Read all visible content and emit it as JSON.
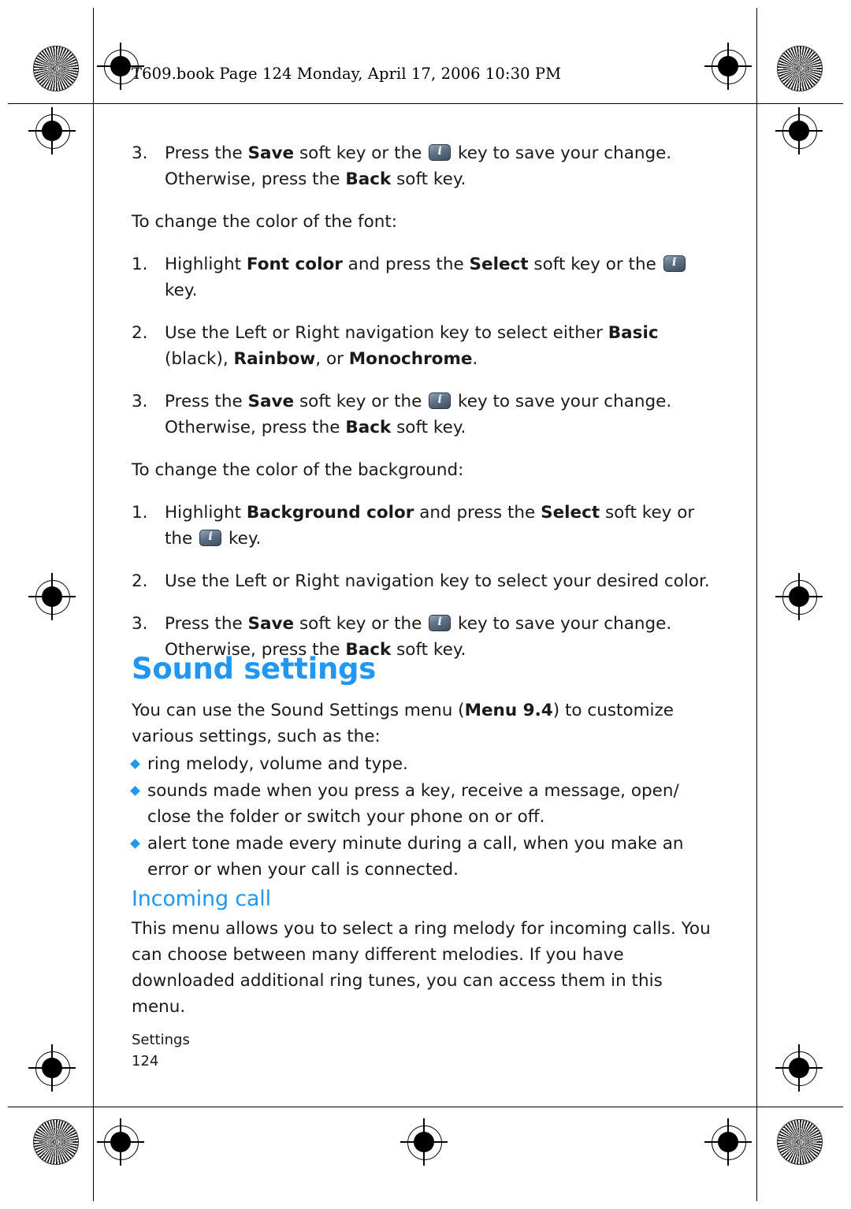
{
  "header": {
    "text": "T609.book  Page 124  Monday, April 17, 2006  10:30 PM"
  },
  "body": {
    "step3a": {
      "num": "3.",
      "part1": "Press the ",
      "save": "Save",
      "part2": " soft key or the ",
      "part3": " key to save your change. Otherwise, press the ",
      "back": "Back",
      "part4": " soft key."
    },
    "intro_font_color": "To change the color of the font:",
    "step1_font": {
      "num": "1.",
      "part1": "Highlight ",
      "bold1": "Font color",
      "part2": " and press the ",
      "bold2": "Select",
      "part3": " soft key or the ",
      "part4": " key."
    },
    "step2_font": {
      "num": "2.",
      "part1": "Use the Left or Right navigation key to select either ",
      "bold1": "Basic",
      "part2": " (black), ",
      "bold2": "Rainbow",
      "part3": ", or ",
      "bold3": "Monochrome",
      "part4": "."
    },
    "step3b": {
      "num": "3.",
      "part1": "Press the ",
      "save": "Save",
      "part2": " soft key or the ",
      "part3": " key to save your change. Otherwise, press the ",
      "back": "Back",
      "part4": " soft key."
    },
    "intro_bg_color": "To change the color of the background:",
    "step1_bg": {
      "num": "1.",
      "part1": "Highlight ",
      "bold1": "Background color",
      "part2": " and press the ",
      "bold2": "Select",
      "part3": " soft key or the ",
      "part4": " key."
    },
    "step2_bg": {
      "num": "2.",
      "text": "Use the Left or Right navigation key to select your desired color."
    },
    "step3c": {
      "num": "3.",
      "part1": "Press the ",
      "save": "Save",
      "part2": " soft key or the ",
      "part3": " key to save your change. Otherwise, press the ",
      "back": "Back",
      "part4": " soft key."
    }
  },
  "sound_settings": {
    "heading": "Sound settings",
    "intro_part1": "You can use the Sound Settings menu (",
    "intro_bold": "Menu 9.4",
    "intro_part2": ") to customize various settings, such as the:",
    "bullets": [
      "ring melody, volume and type.",
      "sounds made when you press a key, receive a message, open/ close the folder or switch your phone on or off.",
      "alert tone made every minute during a call, when you make an error or when your call is connected."
    ]
  },
  "incoming_call": {
    "heading": "Incoming call",
    "body": "This menu allows you to select a ring melody for incoming calls. You can choose between many different melodies. If you have downloaded additional ring tunes, you can access them in this menu."
  },
  "footer": {
    "section": "Settings",
    "page": "124"
  },
  "colors": {
    "accent": "#2196f3",
    "text": "#1a1a1a"
  }
}
